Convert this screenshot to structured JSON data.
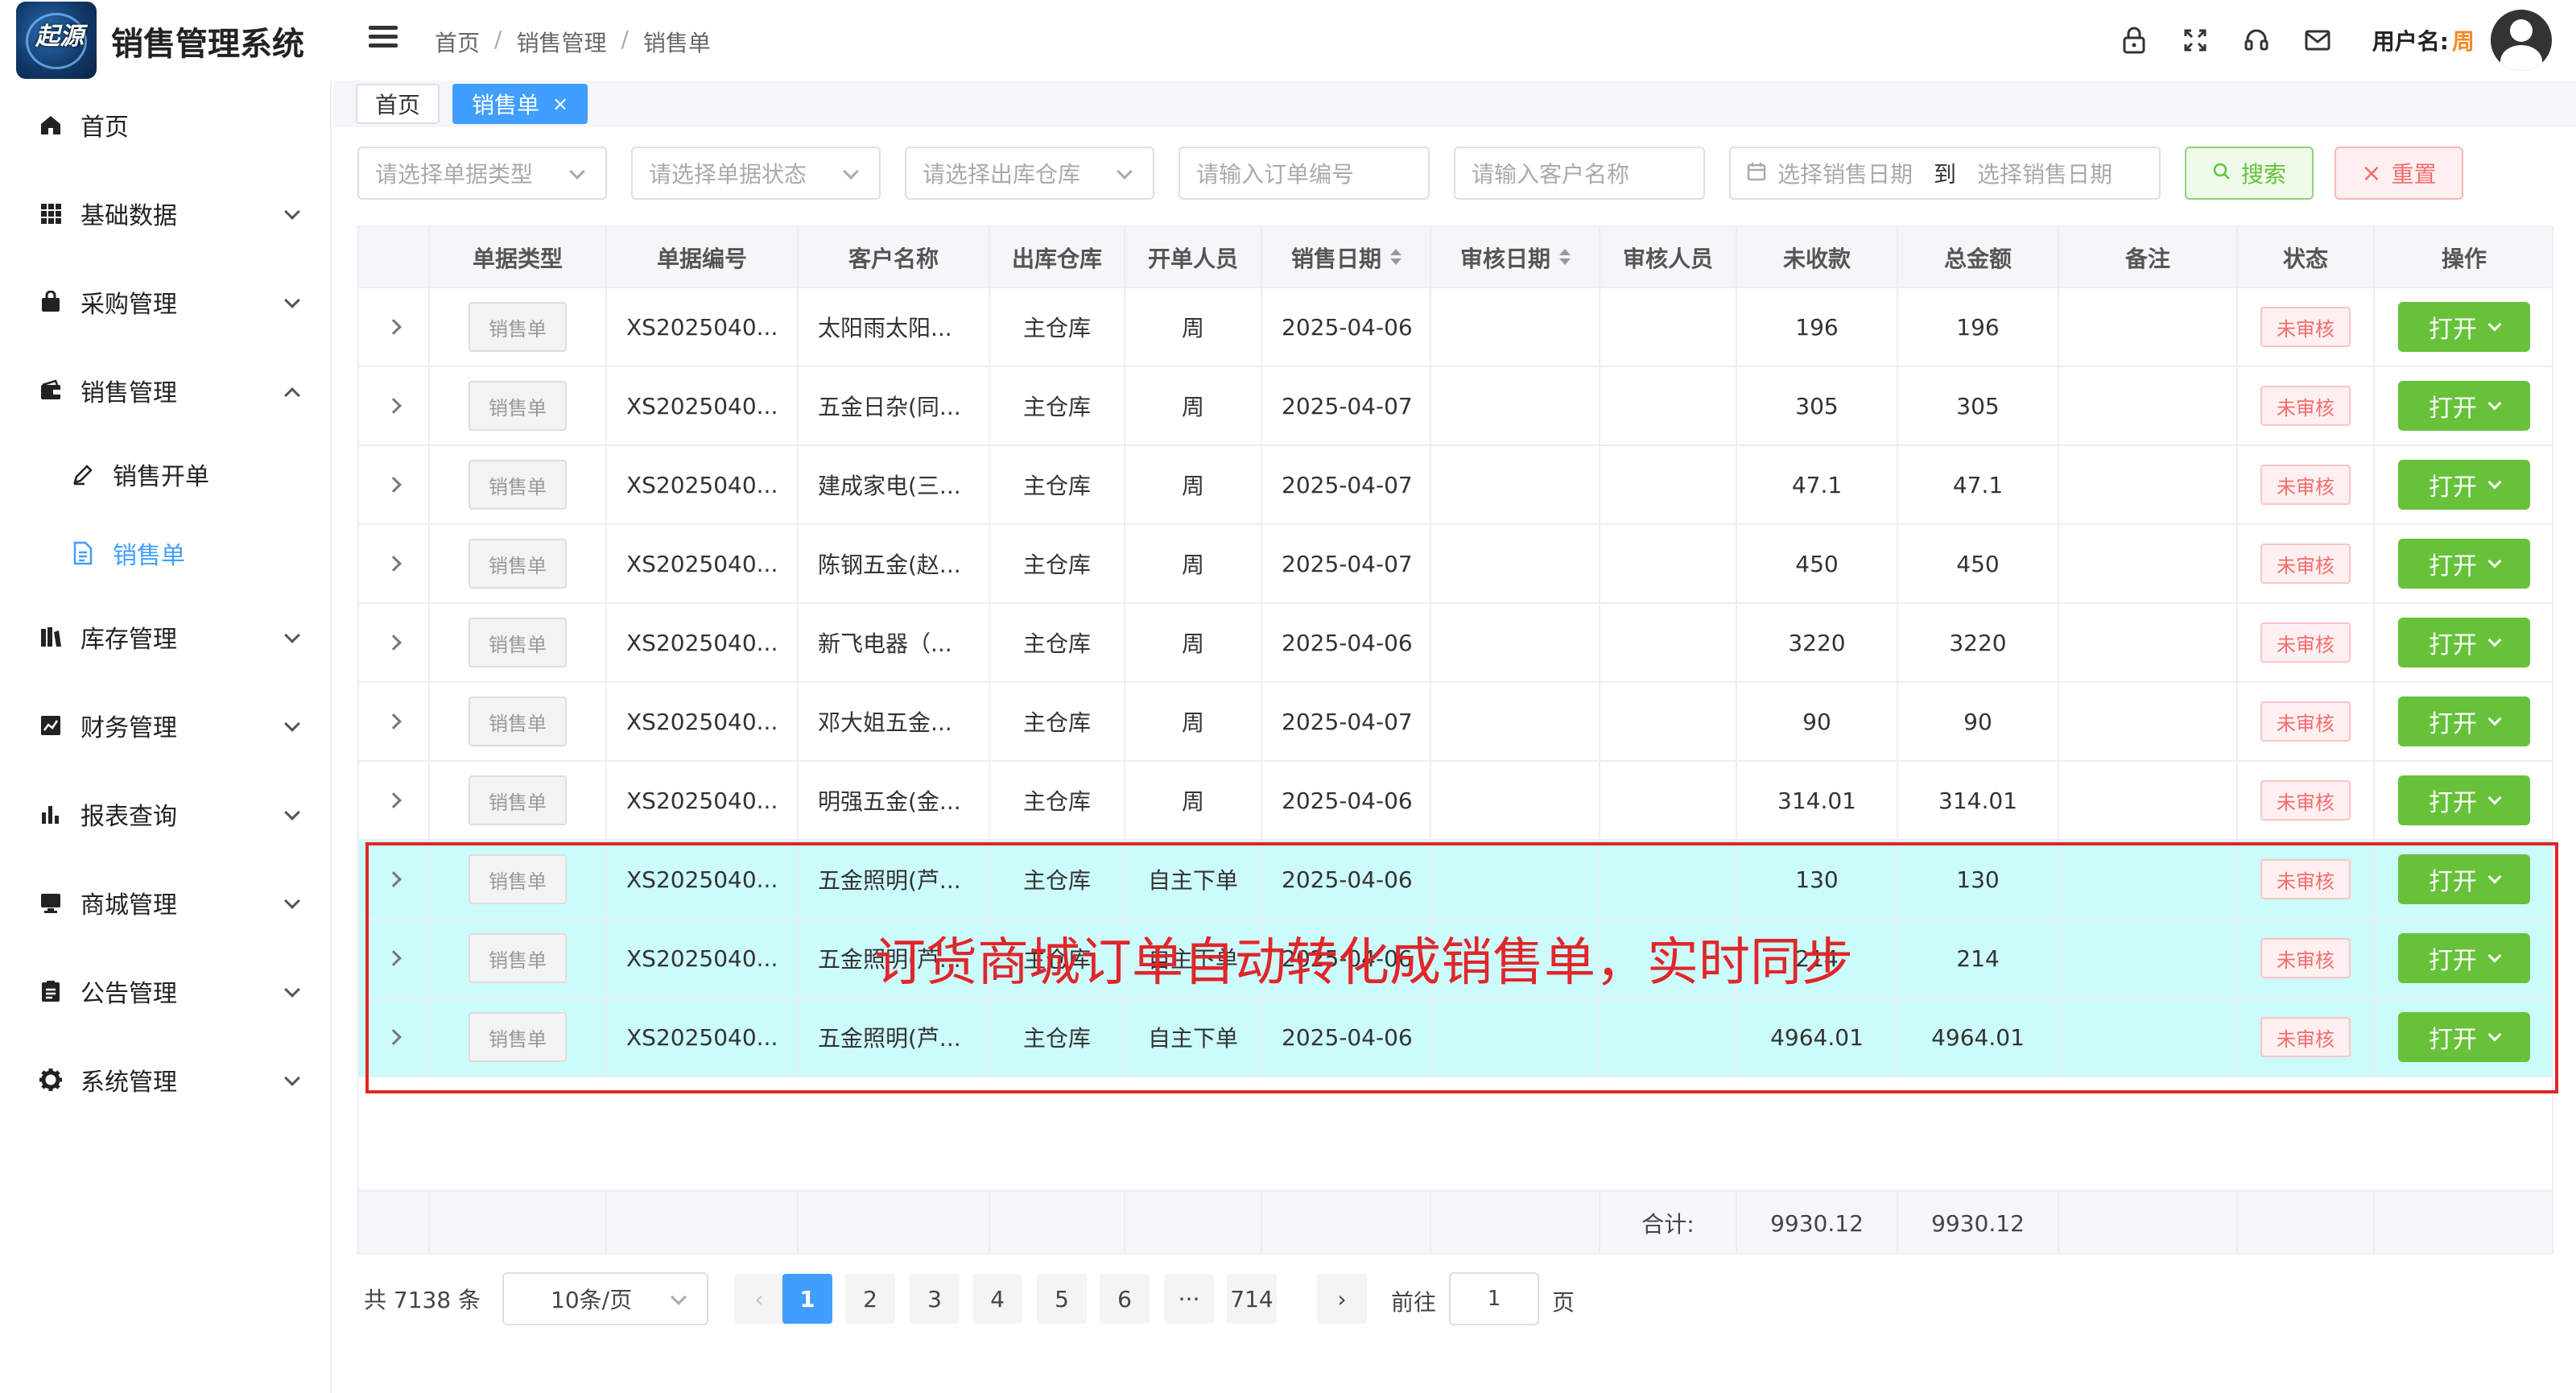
{
  "header": {
    "logo_text": "起源",
    "app_title": "销售管理系统",
    "breadcrumb": [
      "首页",
      "销售管理",
      "销售单"
    ],
    "user_label": "用户名:",
    "user_name": "周",
    "icons": [
      "lock-icon",
      "fullscreen-icon",
      "headset-icon",
      "mail-icon"
    ]
  },
  "sidebar": {
    "items": [
      {
        "label": "首页",
        "icon": "home-icon"
      },
      {
        "label": "基础数据",
        "icon": "grid-icon"
      },
      {
        "label": "采购管理",
        "icon": "bag-icon"
      },
      {
        "label": "销售管理",
        "icon": "wallet-icon",
        "expanded": true
      },
      {
        "label": "库存管理",
        "icon": "warehouse-icon"
      },
      {
        "label": "财务管理",
        "icon": "trend-icon"
      },
      {
        "label": "报表查询",
        "icon": "bar-chart-icon"
      },
      {
        "label": "商城管理",
        "icon": "monitor-icon"
      },
      {
        "label": "公告管理",
        "icon": "notice-icon"
      },
      {
        "label": "系统管理",
        "icon": "gear-icon"
      }
    ],
    "sub_items": [
      {
        "label": "销售开单",
        "icon": "pen-icon"
      },
      {
        "label": "销售单",
        "icon": "document-icon",
        "active": true
      }
    ]
  },
  "tabs": [
    {
      "label": "首页"
    },
    {
      "label": "销售单",
      "active": true,
      "close": "×"
    }
  ],
  "filters": {
    "doc_type": "请选择单据类型",
    "doc_status": "请选择单据状态",
    "warehouse": "请选择出库仓库",
    "order_no": "请输入订单编号",
    "customer": "请输入客户名称",
    "date_start": "选择销售日期",
    "date_sep": "到",
    "date_end": "选择销售日期",
    "search": "搜索",
    "reset": "重置"
  },
  "table": {
    "columns": [
      "单据类型",
      "单据编号",
      "客户名称",
      "出库仓库",
      "开单人员",
      "销售日期",
      "审核日期",
      "审核人员",
      "未收款",
      "总金额",
      "备注",
      "状态",
      "操作"
    ],
    "rows": [
      {
        "type": "销售单",
        "no": "XS2025040...",
        "customer": "太阳雨太阳...",
        "warehouse": "主仓库",
        "creator": "周",
        "date": "2025-04-06",
        "audit_date": "",
        "auditor": "",
        "unpaid": "196",
        "total": "196",
        "remark": "",
        "status": "未审核",
        "action": "打开"
      },
      {
        "type": "销售单",
        "no": "XS2025040...",
        "customer": "五金日杂(同...",
        "warehouse": "主仓库",
        "creator": "周",
        "date": "2025-04-07",
        "audit_date": "",
        "auditor": "",
        "unpaid": "305",
        "total": "305",
        "remark": "",
        "status": "未审核",
        "action": "打开"
      },
      {
        "type": "销售单",
        "no": "XS2025040...",
        "customer": "建成家电(三...",
        "warehouse": "主仓库",
        "creator": "周",
        "date": "2025-04-07",
        "audit_date": "",
        "auditor": "",
        "unpaid": "47.1",
        "total": "47.1",
        "remark": "",
        "status": "未审核",
        "action": "打开"
      },
      {
        "type": "销售单",
        "no": "XS2025040...",
        "customer": "陈钢五金(赵...",
        "warehouse": "主仓库",
        "creator": "周",
        "date": "2025-04-07",
        "audit_date": "",
        "auditor": "",
        "unpaid": "450",
        "total": "450",
        "remark": "",
        "status": "未审核",
        "action": "打开"
      },
      {
        "type": "销售单",
        "no": "XS2025040...",
        "customer": "新飞电器（...",
        "warehouse": "主仓库",
        "creator": "周",
        "date": "2025-04-06",
        "audit_date": "",
        "auditor": "",
        "unpaid": "3220",
        "total": "3220",
        "remark": "",
        "status": "未审核",
        "action": "打开"
      },
      {
        "type": "销售单",
        "no": "XS2025040...",
        "customer": "邓大姐五金...",
        "warehouse": "主仓库",
        "creator": "周",
        "date": "2025-04-07",
        "audit_date": "",
        "auditor": "",
        "unpaid": "90",
        "total": "90",
        "remark": "",
        "status": "未审核",
        "action": "打开"
      },
      {
        "type": "销售单",
        "no": "XS2025040...",
        "customer": "明强五金(金...",
        "warehouse": "主仓库",
        "creator": "周",
        "date": "2025-04-06",
        "audit_date": "",
        "auditor": "",
        "unpaid": "314.01",
        "total": "314.01",
        "remark": "",
        "status": "未审核",
        "action": "打开"
      },
      {
        "type": "销售单",
        "no": "XS2025040...",
        "customer": "五金照明(芦...",
        "warehouse": "主仓库",
        "creator": "自主下单",
        "date": "2025-04-06",
        "audit_date": "",
        "auditor": "",
        "unpaid": "130",
        "total": "130",
        "remark": "",
        "status": "未审核",
        "action": "打开",
        "highlight": true
      },
      {
        "type": "销售单",
        "no": "XS2025040...",
        "customer": "五金照明(芦...",
        "warehouse": "主仓库",
        "creator": "自主下单",
        "date": "2025-04-06",
        "audit_date": "",
        "auditor": "",
        "unpaid": "214",
        "total": "214",
        "remark": "",
        "status": "未审核",
        "action": "打开",
        "highlight": true
      },
      {
        "type": "销售单",
        "no": "XS2025040...",
        "customer": "五金照明(芦...",
        "warehouse": "主仓库",
        "creator": "自主下单",
        "date": "2025-04-06",
        "audit_date": "",
        "auditor": "",
        "unpaid": "4964.01",
        "total": "4964.01",
        "remark": "",
        "status": "未审核",
        "action": "打开",
        "highlight": true
      }
    ],
    "summary": {
      "label": "合计:",
      "unpaid": "9930.12",
      "total": "9930.12"
    }
  },
  "annotation": "订货商城订单自动转化成销售单，实时同步",
  "pagination": {
    "total_text": "共 7138 条",
    "page_size": "10条/页",
    "pages": [
      "1",
      "2",
      "3",
      "4",
      "5",
      "6",
      "···",
      "714"
    ],
    "current": "1",
    "goto_label": "前往",
    "goto_value": "1",
    "page_suffix": "页"
  },
  "colors": {
    "primary": "#409eff",
    "success": "#67c23a",
    "danger": "#f56c6c",
    "highlight_row": "#ccfbfb",
    "annotation": "#e0262a"
  }
}
